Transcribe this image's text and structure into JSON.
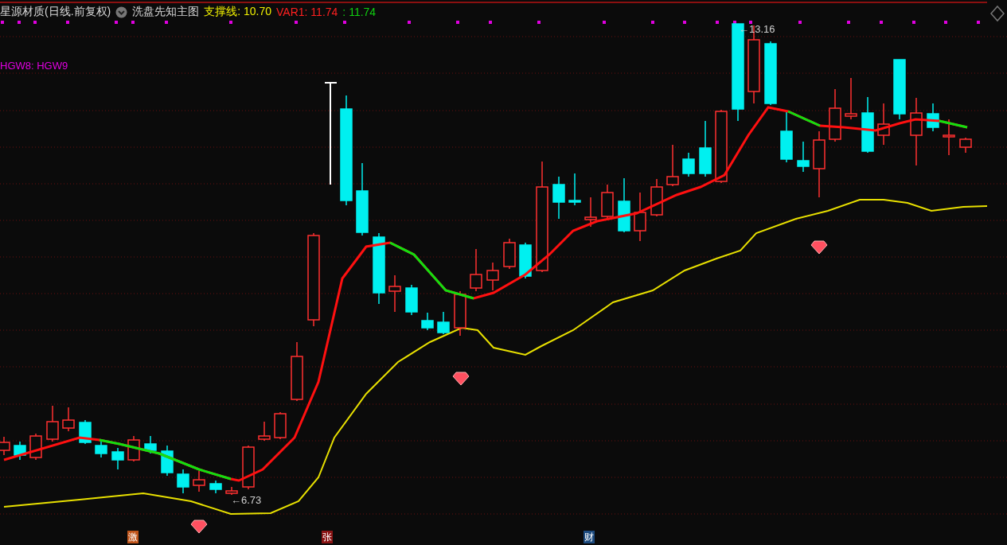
{
  "header": {
    "stock": "星源材质(日线.前复权)",
    "indicator": "洗盘先知主图",
    "support": "支撑线: 10.70",
    "var1": "VAR1: 11.74",
    "var_green": ": 11.74"
  },
  "legend": "HGW8: HGW9",
  "price_labels": [
    "←13.16",
    "←6.73"
  ],
  "markers": [
    {
      "text": "激",
      "color": "#c0541a"
    },
    {
      "text": "张",
      "color": "#8a1414"
    },
    {
      "text": "财",
      "color": "#1c4a7e"
    }
  ]
}
